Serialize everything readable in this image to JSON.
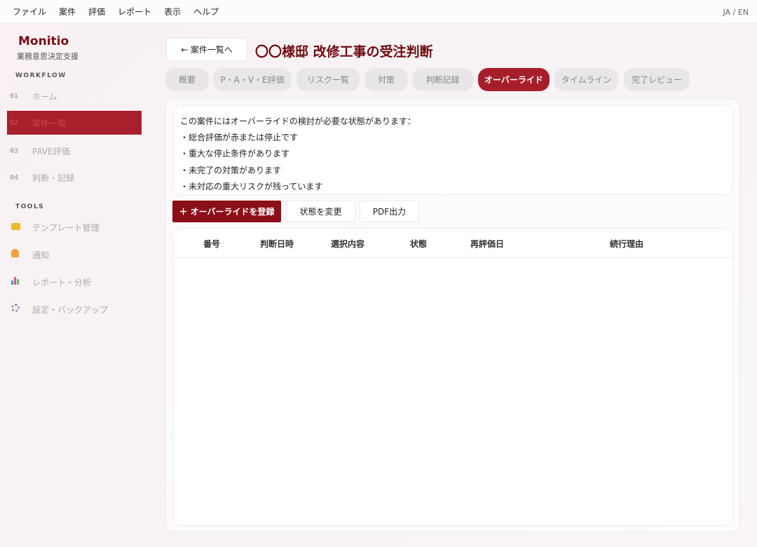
{
  "menu": {
    "items": [
      "ファイル",
      "案件",
      "評価",
      "レポート",
      "表示",
      "ヘルプ"
    ],
    "lang_toggle": "JA / EN"
  },
  "sidebar": {
    "brand": "Monitio",
    "brand_sub": "業務意思決定支援",
    "workflow_label": "WORKFLOW",
    "workflow_items": [
      {
        "num": "01",
        "label": "ホーム"
      },
      {
        "num": "02",
        "label": "案件一覧"
      },
      {
        "num": "03",
        "label": "PAVE評価"
      },
      {
        "num": "04",
        "label": "判断・記録"
      }
    ],
    "tools_label": "TOOLS",
    "tools_items": [
      {
        "icon": "folder-icon",
        "label": "テンプレート管理"
      },
      {
        "icon": "bell-icon",
        "label": "通知"
      },
      {
        "icon": "chart-icon",
        "label": "レポート・分析"
      },
      {
        "icon": "gear-icon",
        "label": "設定・バックアップ"
      }
    ],
    "active_index": 1
  },
  "header": {
    "back_label": "← 案件一覧へ",
    "title": "〇〇様邸 改修工事の受注判断"
  },
  "tabs": [
    "概要",
    "P・A・V・E評価",
    "リスク一覧",
    "対策",
    "判断記録",
    "オーバーライド",
    "タイムライン",
    "完了レビュー"
  ],
  "active_tab": "オーバーライド",
  "notice": {
    "heading": "この案件にはオーバーライドの検討が必要な状態があります：",
    "lines": [
      "・総合評価が赤または停止です",
      "・重大な停止条件があります",
      "・未完了の対策があります",
      "・未対応の重大リスクが残っています"
    ]
  },
  "actions": {
    "register": "＋ オーバーライドを登録",
    "change_status": "状態を変更",
    "pdf": "PDF出力"
  },
  "table": {
    "columns": [
      "番号",
      "判断日時",
      "選択内容",
      "状態",
      "再評価日",
      "続行理由"
    ],
    "rows": []
  },
  "colors": {
    "accent": "#a61e2a",
    "brand": "#7a0c14",
    "primary_button": "#8b0f18"
  }
}
